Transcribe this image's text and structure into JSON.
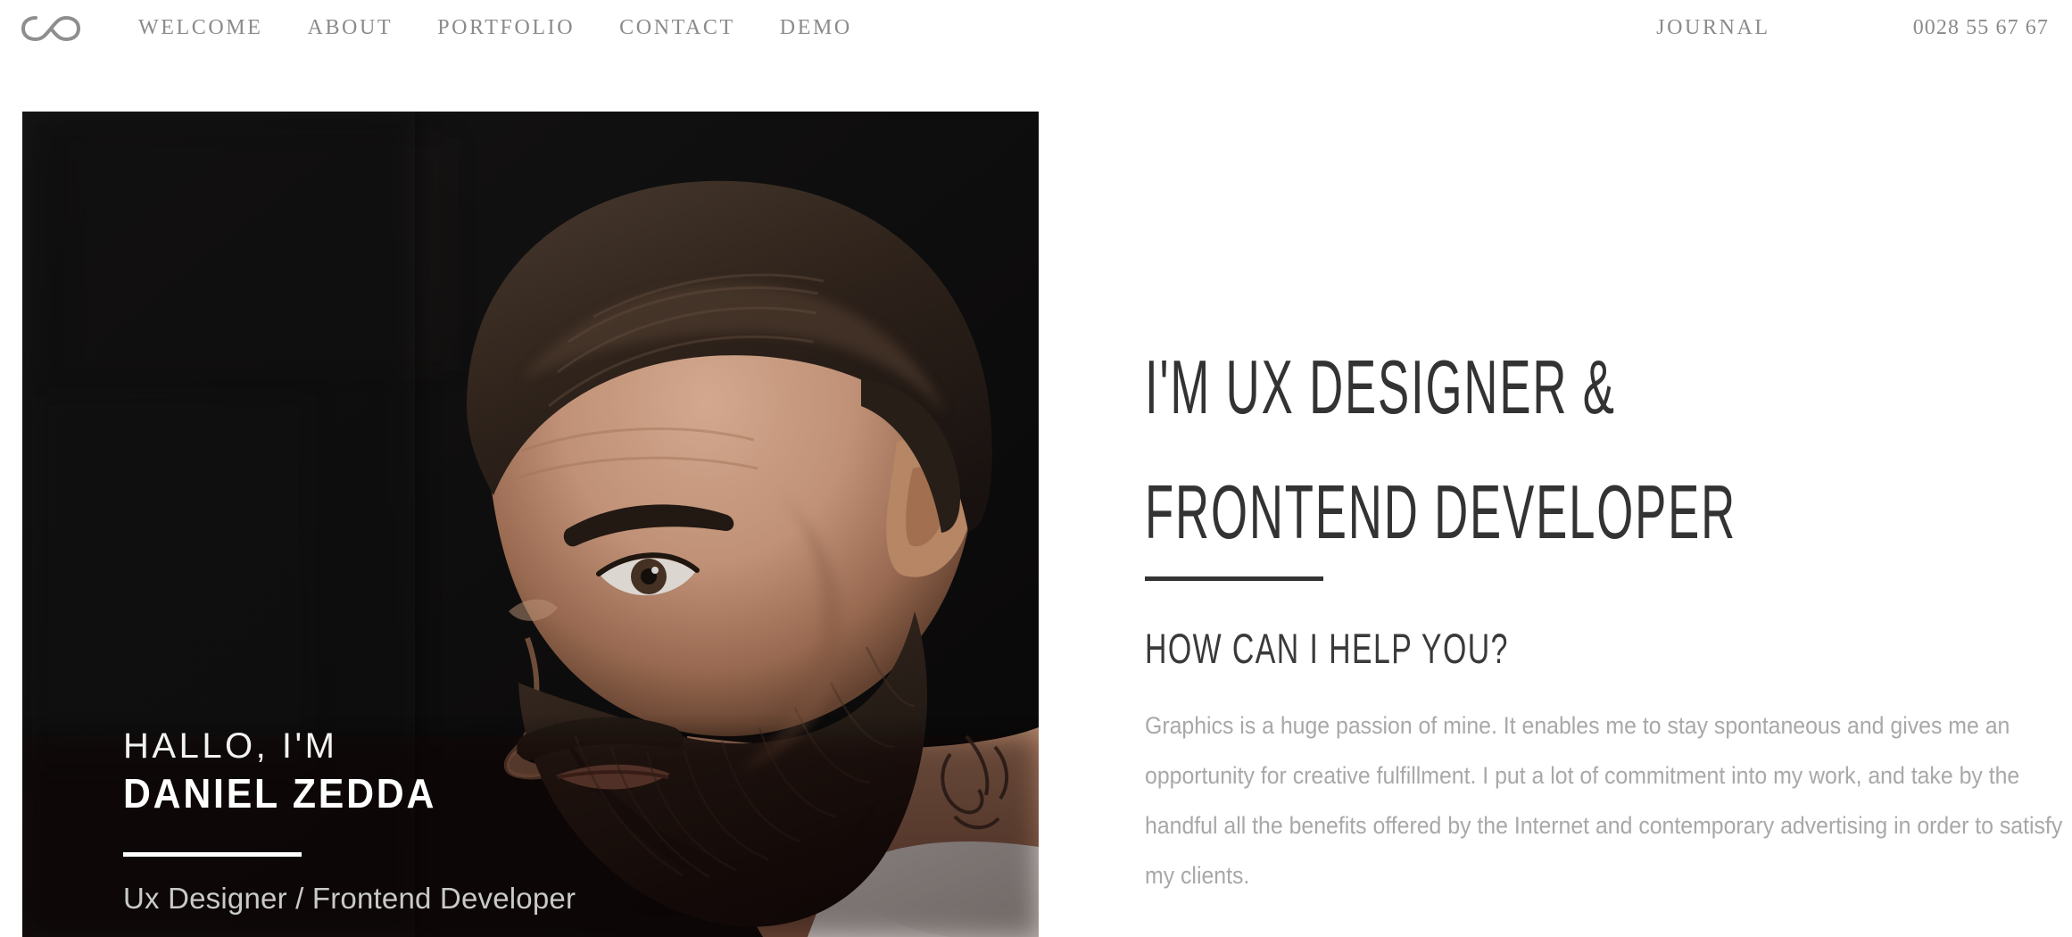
{
  "header": {
    "logo_icon": "infinity-icon",
    "nav_items": [
      {
        "label": "WELCOME"
      },
      {
        "label": "ABOUT"
      },
      {
        "label": "PORTFOLIO"
      },
      {
        "label": "CONTACT"
      },
      {
        "label": "DEMO"
      }
    ],
    "journal_label": "JOURNAL",
    "phone": "0028 55 67 67"
  },
  "hero": {
    "photo_alt": "portrait-of-bearded-man",
    "greeting": "HALLO, I'M",
    "name": "DANIEL ZEDDA",
    "role": "Ux Designer / Frontend Developer"
  },
  "intro": {
    "heading_line1": "I'M UX DESIGNER &",
    "heading_line2": "FRONTEND DEVELOPER",
    "subheading": "HOW CAN I HELP YOU?",
    "body": "Graphics is a huge passion of mine. It enables me to stay spontaneous and gives me an opportunity for creative fulfillment. I put a lot of commitment into my work, and take by the handful all the benefits offered by the Internet and contemporary advertising in order to satisfy my clients."
  },
  "colors": {
    "page_background": "#ffffff",
    "nav_text": "#8c8a8c",
    "heading_text": "#333333",
    "body_text": "#a8a8a8",
    "overlay_name": "#ffffff",
    "overlay_role": "#c9c9c9",
    "photo_background": "#0d0c0c",
    "rule_dark": "#333333",
    "rule_light": "#ffffff"
  }
}
